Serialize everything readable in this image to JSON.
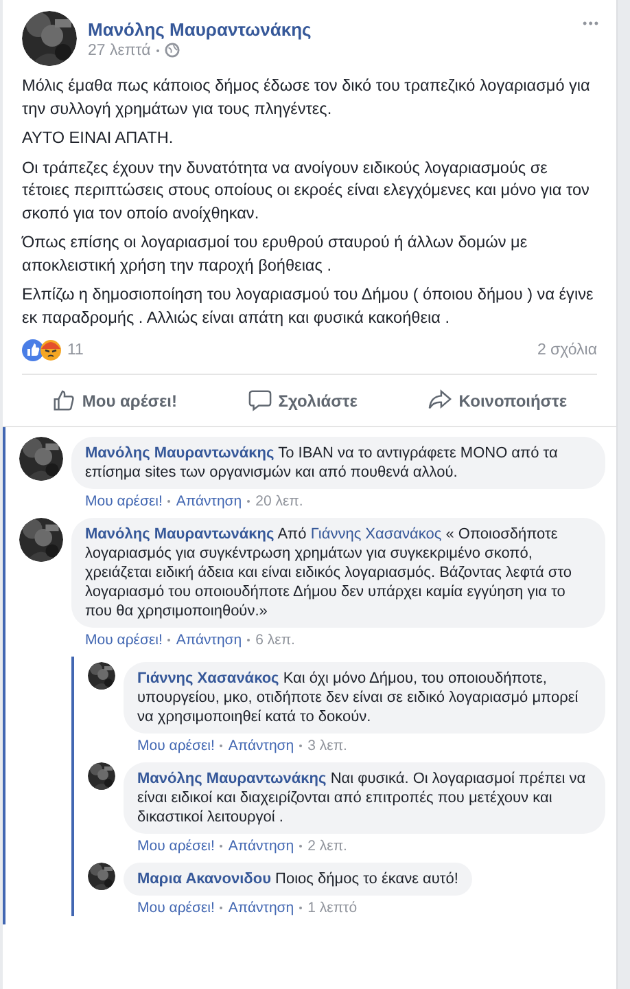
{
  "post": {
    "author": "Μανόλης Μαυραντωνάκης",
    "time": "27 λεπτά",
    "more": "•••",
    "paragraphs": [
      "Μόλις έμαθα πως κάποιος δήμος έδωσε τον δικό του τραπεζικό λογαριασμό για την συλλογή χρημάτων για τους πληγέντες.",
      "ΑΥΤΟ ΕΙΝΑΙ ΑΠΑΤΗ.",
      "Οι τράπεζες έχουν την δυνατότητα να ανοίγουν ειδικούς λογαριασμούς σε τέτοιες περιπτώσεις στους οποίους οι εκροές είναι ελεγχόμενες και μόνο για τον σκοπό για τον οποίο ανοίχθηκαν.",
      "Όπως επίσης οι λογαριασμοί του ερυθρού σταυρού ή άλλων δομών με αποκλειστική χρήση την παροχή βοήθειας .",
      "Ελπίζω η δημοσιοποίηση του λογαριασμού του Δήμου ( όποιου δήμου ) να έγινε εκ παραδρομής . Αλλιώς είναι απάτη και φυσικά κακοήθεια ."
    ],
    "reaction_count": "11",
    "comment_count": "2 σχόλια"
  },
  "actions": [
    {
      "kind": "like",
      "label": "Μου αρέσει!"
    },
    {
      "kind": "comment",
      "label": "Σχολιάστε"
    },
    {
      "kind": "share",
      "label": "Κοινοποιήστε"
    }
  ],
  "comments": [
    {
      "author": "Μανόλης Μαυραντωνάκης",
      "text": "Το IBAN να το αντιγράφετε ΜΟΝΟ από τα επίσημα sites των οργανισμών και από πουθενά αλλού.",
      "like": "Μου αρέσει!",
      "reply": "Απάντηση",
      "time": "20 λεπ."
    },
    {
      "author": "Μανόλης Μαυραντωνάκης",
      "prefix": "Από",
      "mention": "Γιάννης Χασανάκος",
      "text": "« Οποιοσδήποτε λογαριασμός για συγκέντρωση χρημάτων για συγκεκριμένο σκοπό, χρειάζεται ειδική άδεια και είναι ειδικός λογαριασμός. Βάζοντας λεφτά στο λογαριασμό του οποιουδήποτε Δήμου δεν υπάρχει καμία εγγύηση για το που θα χρησιμοποιηθούν.»",
      "like": "Μου αρέσει!",
      "reply": "Απάντηση",
      "time": "6 λεπ.",
      "children": [
        {
          "author": "Γιάννης Χασανάκος",
          "text": "Και όχι μόνο Δήμου, του οποιουδήποτε, υπουργείου, μκο, οτιδήποτε δεν είναι σε ειδικό λογαριασμό μπορεί να χρησιμοποιηθεί κατά το δοκούν.",
          "like": "Μου αρέσει!",
          "reply": "Απάντηση",
          "time": "3 λεπ."
        },
        {
          "author": "Μανόλης Μαυραντωνάκης",
          "text": "Ναι φυσικά. Οι λογαριασμοί πρέπει να είναι ειδικοί και διαχειρίζονται από επιτροπές που μετέχουν και δικαστικοί λειτουργοί .",
          "like": "Μου αρέσει!",
          "reply": "Απάντηση",
          "time": "2 λεπ."
        },
        {
          "author": "Μαρια Ακανονιδου",
          "text": "Ποιος δήμος το έκανε αυτό!",
          "like": "Μου αρέσει!",
          "reply": "Απάντηση",
          "time": "1 λεπτό"
        }
      ]
    }
  ]
}
